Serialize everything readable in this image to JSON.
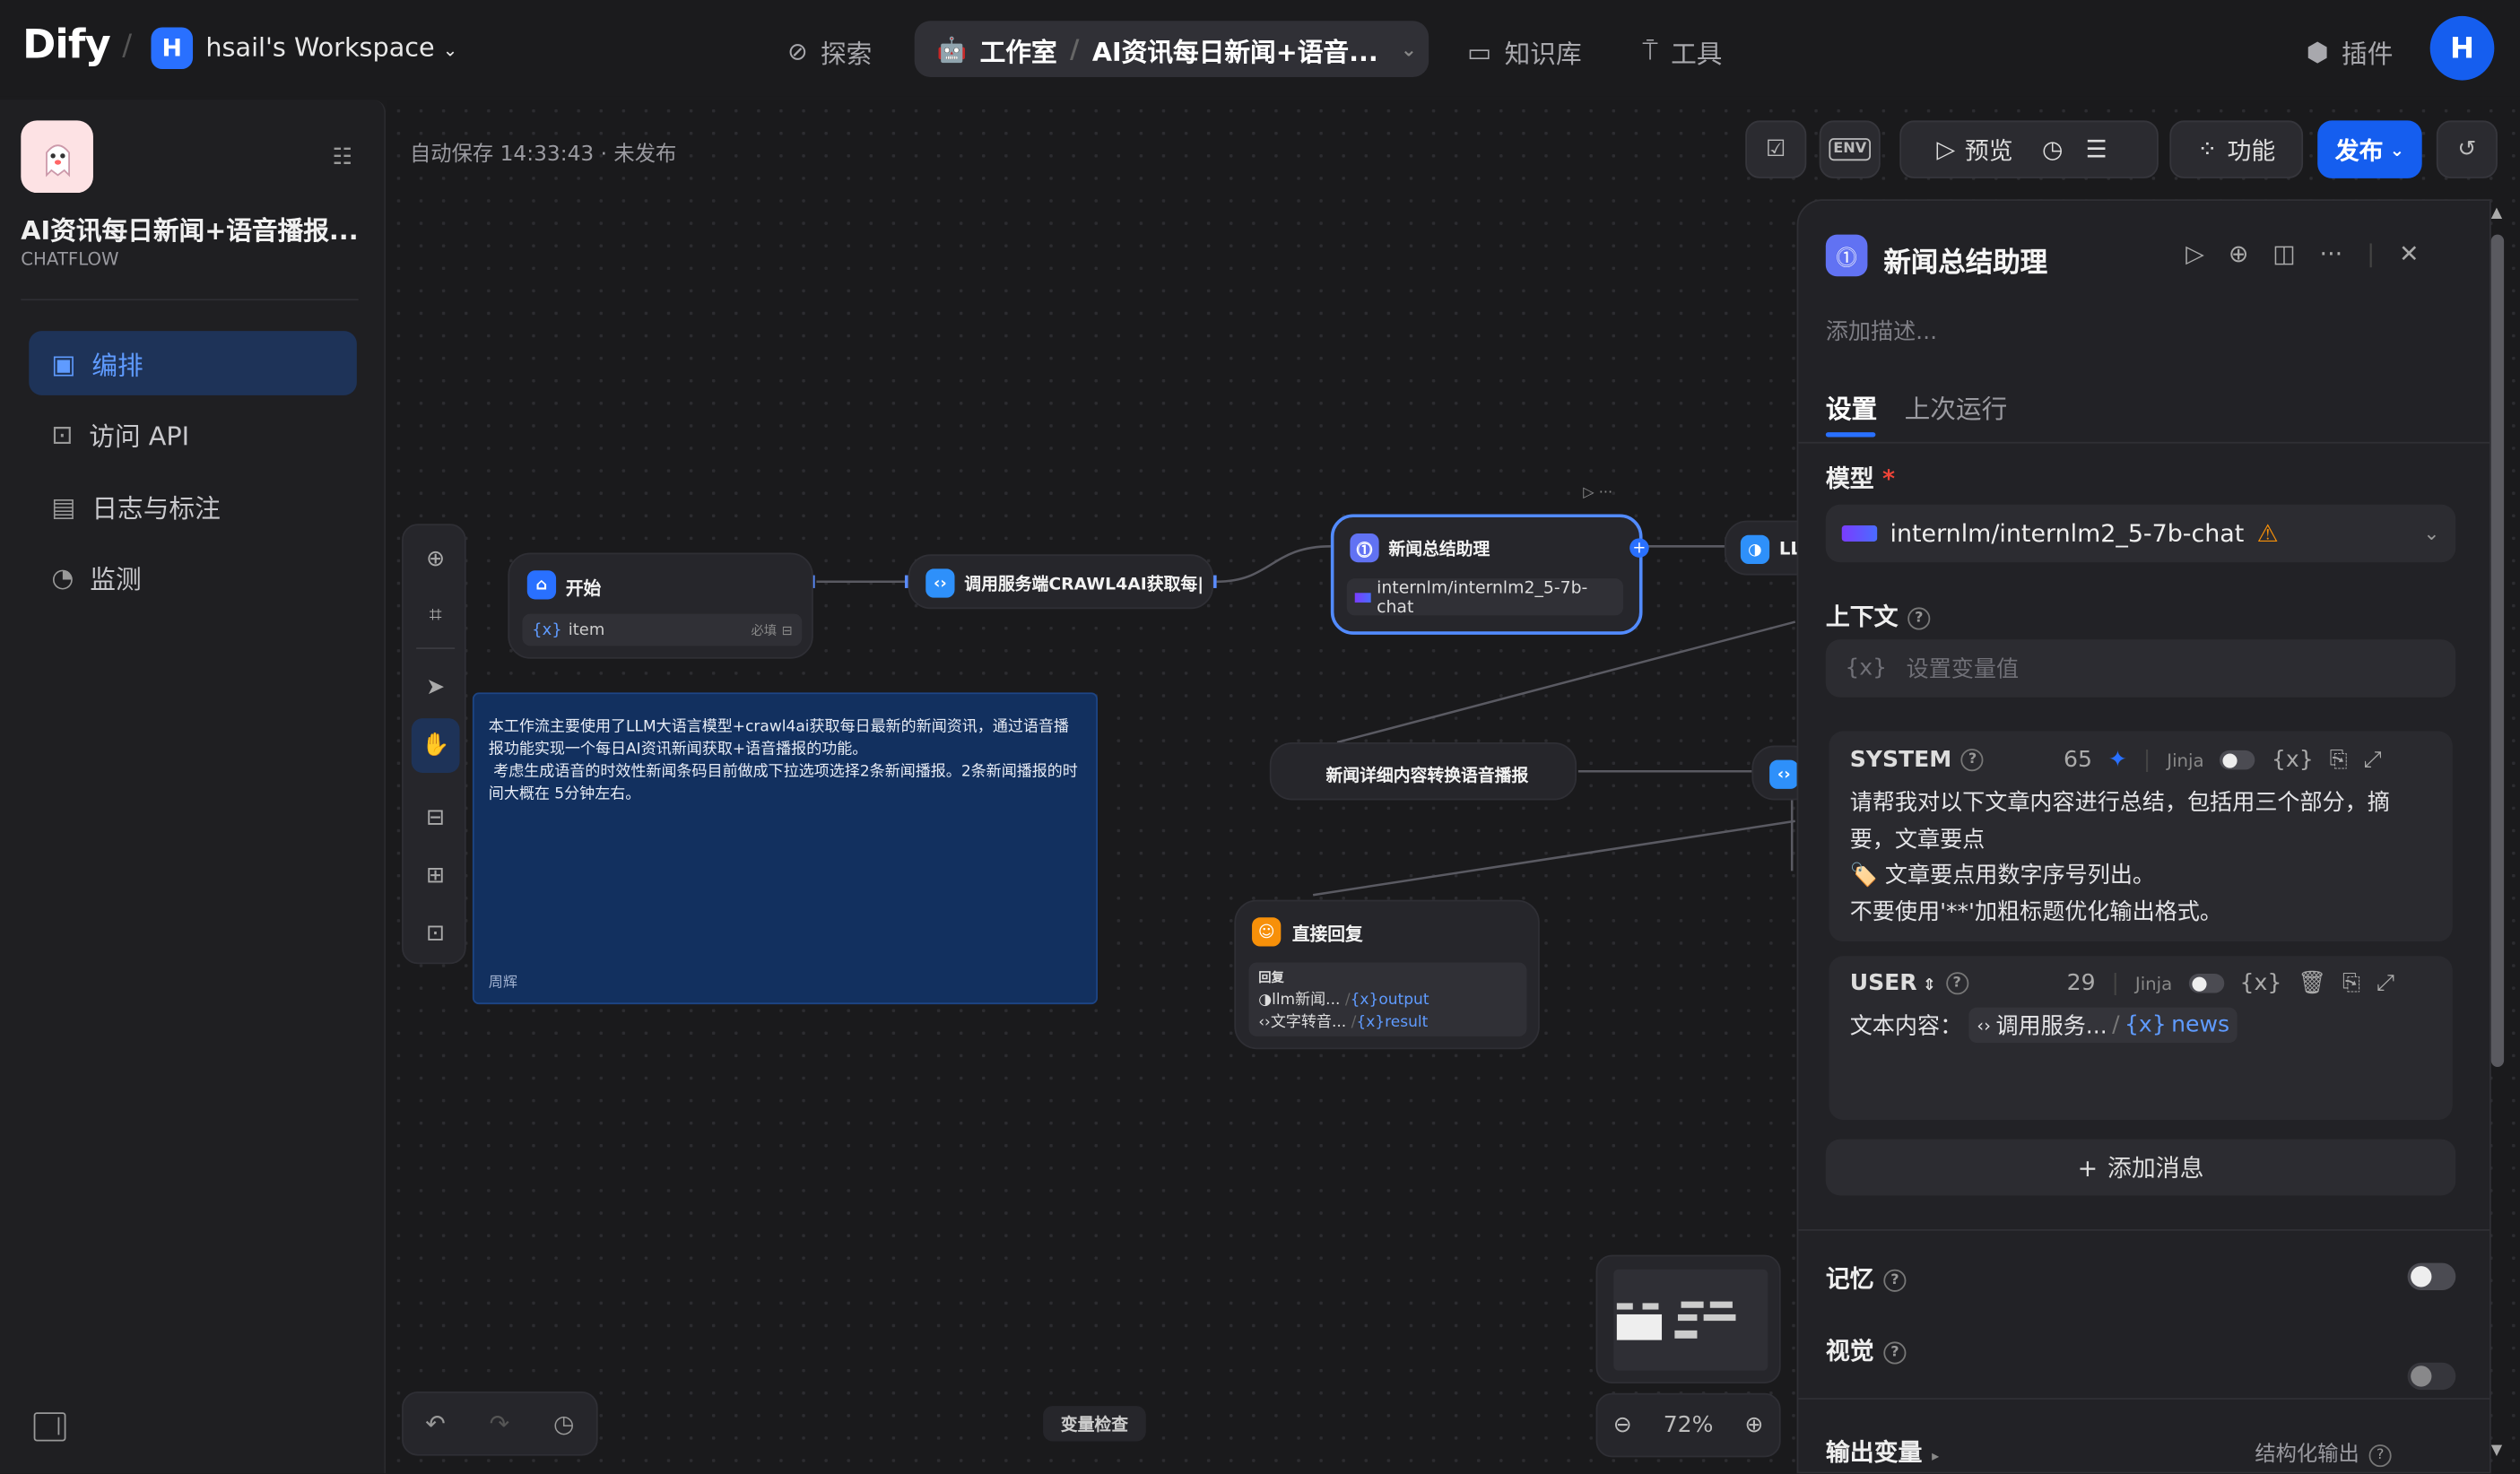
{
  "topbar": {
    "logo": "Dify",
    "workspace_initial": "H",
    "workspace_name": "hsail's Workspace",
    "nav_explore": "探索",
    "nav_studio": "工作室",
    "current_app": "AI资讯每日新闻+语音...",
    "nav_knowledge": "知识库",
    "nav_tools": "工具",
    "plugins": "插件",
    "avatar_initial": "H"
  },
  "sidebar": {
    "app_name": "AI资讯每日新闻+语音播报...",
    "app_type": "CHATFLOW",
    "items": [
      {
        "label": "编排",
        "icon": "layout-icon",
        "active": true
      },
      {
        "label": "访问 API",
        "icon": "terminal-icon",
        "active": false
      },
      {
        "label": "日志与标注",
        "icon": "log-icon",
        "active": false
      },
      {
        "label": "监测",
        "icon": "monitor-icon",
        "active": false
      }
    ]
  },
  "canvas": {
    "autosave": "自动保存 14:33:43 · 未发布",
    "preview": "预览",
    "features": "功能",
    "publish": "发布",
    "env": "ENV",
    "var_inspect": "变量检查",
    "zoom": "72%",
    "nodes": {
      "start_title": "开始",
      "start_var": "item",
      "start_req": "必填",
      "http_title": "调用服务端CRAWL4AI获取每|",
      "llm_title": "新闻总结助理",
      "llm_model": "internlm/internlm2_5-7b-chat",
      "llm2_partial": "LL",
      "tts_title": "新闻详细内容转换语音播报",
      "answer_title": "直接回复",
      "answer_label": "回复",
      "answer_row1_src": "llm新闻...",
      "answer_row1_var": "output",
      "answer_row2_src": "文字转音...",
      "answer_row2_var": "result"
    },
    "note": {
      "text": "本工作流主要使用了LLM大语言模型+crawl4ai获取每日最新的新闻资讯，通过语音播报功能实现一个每日AI资讯新闻获取+语音播报的功能。\n 考虑生成语音的时效性新闻条码目前做成下拉选项选择2条新闻播报。2条新闻播报的时间大概在 5分钟左右。",
      "author": "周辉"
    }
  },
  "panel": {
    "title": "新闻总结助理",
    "desc_placeholder": "添加描述...",
    "tab_settings": "设置",
    "tab_last_run": "上次运行",
    "model_label": "模型",
    "model_value": "internlm/internlm2_5-7b-chat",
    "context_label": "上下文",
    "context_placeholder": "设置变量值",
    "system_label": "SYSTEM",
    "system_count": "65",
    "jinja": "Jinja",
    "system_lines": [
      "请帮我对以下文章内容进行总结，包括用三个部分，摘",
      "要，文章要点",
      "🏷️ 文章要点用数字序号列出。",
      "不要使用'**'加粗标题优化输出格式。"
    ],
    "user_label": "USER",
    "user_count": "29",
    "user_text": "文本内容：",
    "user_var_src": "调用服务...",
    "user_var": "news",
    "add_message": "添加消息",
    "memory_label": "记忆",
    "vision_label": "视觉",
    "output_vars": "输出变量",
    "structured_output": "结构化输出"
  },
  "colors": {
    "accent": "#155eef",
    "active_menu_bg": "#1e3358",
    "note_bg": "#12305f",
    "answer_icon": "#f79009",
    "llm_icon": "#6172f3",
    "code_icon": "#2e90fa"
  }
}
